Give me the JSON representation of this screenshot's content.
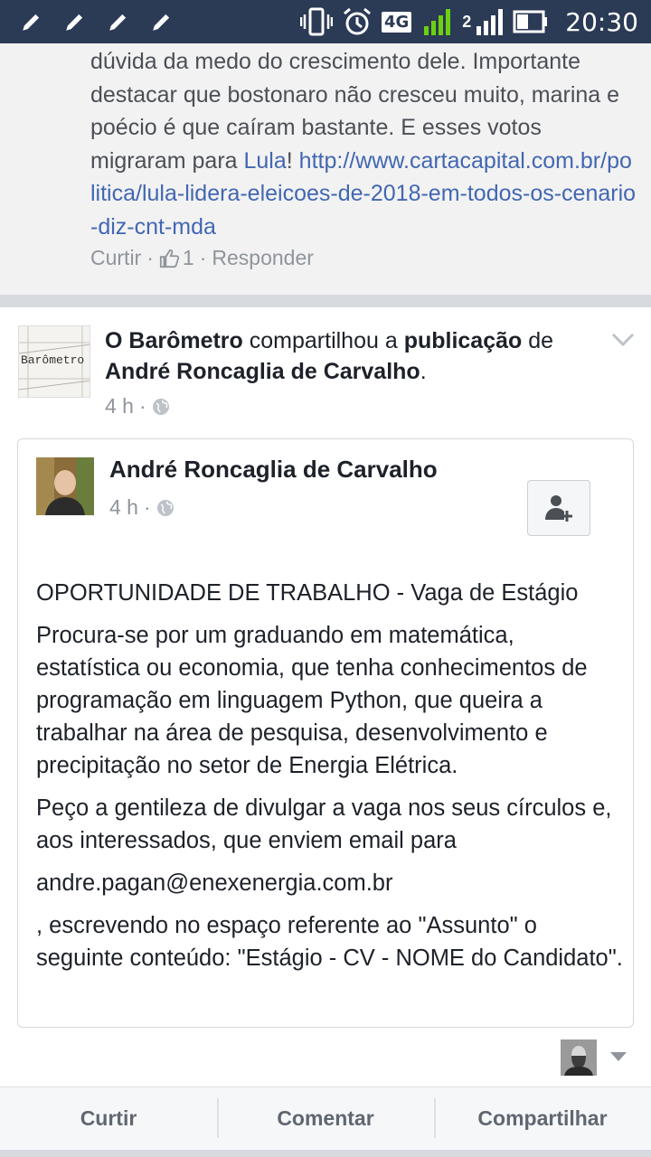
{
  "status_bar": {
    "network": "4G",
    "sim2": "2",
    "time": "20:30"
  },
  "comment": {
    "text_before_link": "dúvida da medo do crescimento dele. Importante destacar que bostonaro não cresceu muito, marina e poécio é que caíram bastante. E esses votos migraram para ",
    "mention": "Lula",
    "exclaim": "! ",
    "url": "http://www.cartacapital.com.br/politica/lula-lidera-eleicoes-de-2018-em-todos-os-cenario-diz-cnt-mda",
    "like_label": "Curtir",
    "like_count": "1",
    "reply_label": "Responder"
  },
  "post": {
    "page_name": "O Barômetro",
    "shared_verb": " compartilhou a ",
    "object": "publicação",
    "of": " de",
    "original_author": "André Roncaglia de Carvalho",
    "period": ".",
    "time": "4 h",
    "page_avatar_text": "Barômetro",
    "shared": {
      "author": "André Roncaglia de Carvalho",
      "time": "4 h",
      "paragraphs": [
        "OPORTUNIDADE DE TRABALHO - Vaga de Estágio",
        "Procura-se por um graduando em matemática, estatística ou economia, que tenha conhecimentos de programação em linguagem Python, que queira a trabalhar na área de pesquisa, desenvolvimento e precipitação no setor de Energia Elétrica.",
        "Peço a gentileza de divulgar a vaga nos seus círculos e, aos interessados, que enviem email para",
        "andre.pagan@enexenergia.com.br",
        ", escrevendo no espaço referente ao \"Assunto\" o seguinte conteúdo: \"Estágio - CV - NOME do Candidato\"."
      ]
    }
  },
  "actions": {
    "like": "Curtir",
    "comment": "Comentar",
    "share": "Compartilhar"
  },
  "colors": {
    "status_bar": "#2b3a55",
    "link": "#4267b2",
    "meta_text": "#90949c"
  }
}
